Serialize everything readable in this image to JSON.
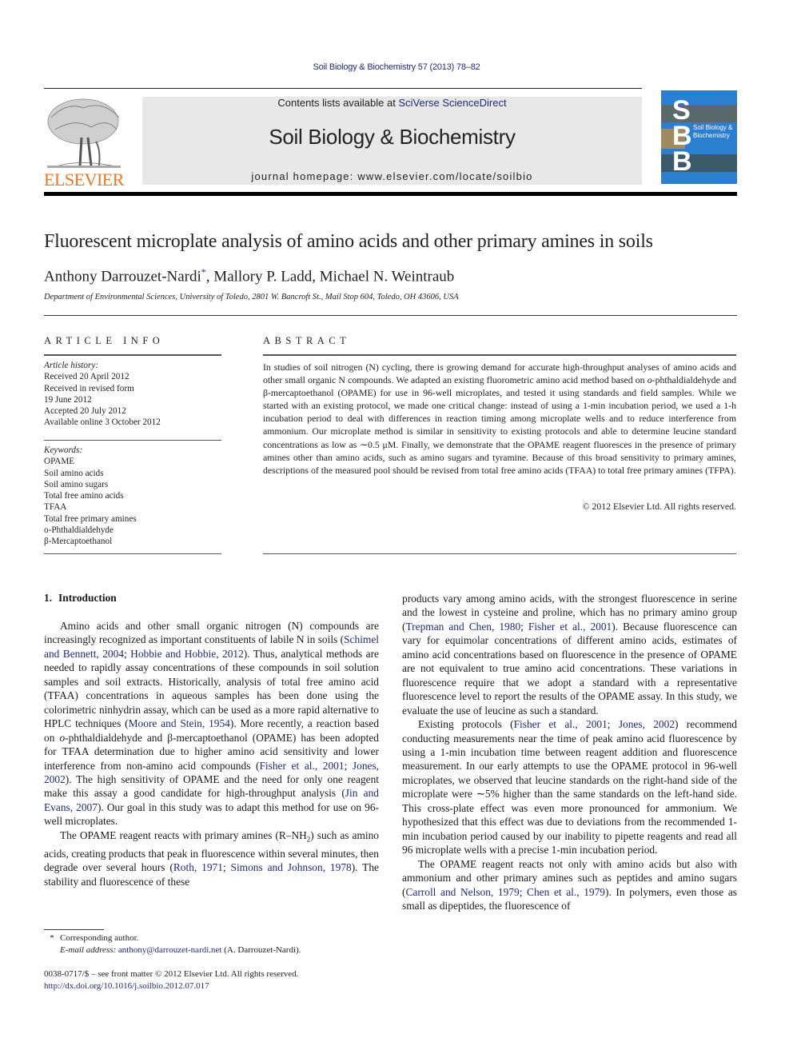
{
  "running_head": "Soil Biology & Biochemistry 57 (2013) 78–82",
  "masthead": {
    "contents_prefix": "Contents lists available at ",
    "contents_link": "SciVerse ScienceDirect",
    "journal_name": "Soil Biology & Biochemistry",
    "homepage_prefix": "journal homepage: ",
    "homepage_url": "www.elsevier.com/locate/soilbio",
    "publisher_logo_text": "ELSEVIER",
    "cover": {
      "letters": [
        "S",
        "B",
        "B"
      ],
      "title_line1": "Soil Biology &",
      "title_line2": "Biochemistry"
    },
    "colors": {
      "elsevier_orange": "#e87722",
      "link_blue": "#1f2a7a",
      "cover_blue": "#2a7fd0",
      "box_gray": "#e8e8e8"
    }
  },
  "article": {
    "title": "Fluorescent microplate analysis of amino acids and other primary amines in soils",
    "authors": [
      {
        "name": "Anthony Darrouzet-Nardi",
        "mark": "*"
      },
      {
        "name": "Mallory P. Ladd"
      },
      {
        "name": "Michael N. Weintraub"
      }
    ],
    "author_sep": ", ",
    "affiliation": "Department of Environmental Sciences, University of Toledo, 2801 W. Bancroft St., Mail Stop 604, Toledo, OH 43606, USA"
  },
  "article_info": {
    "heading": "ARTICLE INFO",
    "history_label": "Article history:",
    "history": [
      "Received 20 April 2012",
      "Received in revised form",
      "19 June 2012",
      "Accepted 20 July 2012",
      "Available online 3 October 2012"
    ],
    "keywords_label": "Keywords:",
    "keywords": [
      "OPAME",
      "Soil amino acids",
      "Soil amino sugars",
      "Total free amino acids",
      "TFAA",
      "Total free primary amines",
      "o-Phthaldialdehyde",
      "β-Mercaptoethanol"
    ]
  },
  "abstract": {
    "heading": "ABSTRACT",
    "text_1": "In studies of soil nitrogen (N) cycling, there is growing demand for accurate high-throughput analyses of amino acids and other small organic N compounds. We adapted an existing fluorometric amino acid method based on ",
    "text_italic": "o",
    "text_2": "-phthaldialdehyde and β-mercaptoethanol (OPAME) for use in 96-well microplates, and tested it using standards and field samples. While we started with an existing protocol, we made one critical change: instead of using a 1-min incubation period, we used a 1-h incubation period to deal with differences in reaction timing among microplate wells and to reduce interference from ammonium. Our microplate method is similar in sensitivity to existing protocols and able to determine leucine standard concentrations as low as ∼0.5 μM. Finally, we demonstrate that the OPAME reagent fluoresces in the presence of primary amines other than amino acids, such as amino sugars and tyramine. Because of this broad sensitivity to primary amines, descriptions of the measured pool should be revised from total free amino acids (TFAA) to total free primary amines (TFPA).",
    "copyright": "© 2012 Elsevier Ltd. All rights reserved."
  },
  "introduction": {
    "number": "1.",
    "heading": "Introduction",
    "left_col": {
      "p1_a": "Amino acids and other small organic nitrogen (N) compounds are increasingly recognized as important constituents of labile N in soils (",
      "p1_l1": "Schimel and Bennett, 2004",
      "p1_b": "; ",
      "p1_l2": "Hobbie and Hobbie, 2012",
      "p1_c": "). Thus, analytical methods are needed to rapidly assay concentrations of these compounds in soil solution samples and soil extracts. Historically, analysis of total free amino acid (TFAA) concentrations in aqueous samples has been done using the colorimetric ninhydrin assay, which can be used as a more rapid alternative to HPLC techniques (",
      "p1_l3": "Moore and Stein, 1954",
      "p1_d": "). More recently, a reaction based on ",
      "p1_i": "o",
      "p1_e": "-phthaldialdehyde and β-mercaptoethanol (OPAME) has been adopted for TFAA determination due to higher amino acid sensitivity and lower interference from non-amino acid compounds (",
      "p1_l4": "Fisher et al., 2001",
      "p1_f": "; ",
      "p1_l5": "Jones, 2002",
      "p1_g": "). The high sensitivity of OPAME and the need for only one reagent make this assay a good candidate for high-throughput analysis (",
      "p1_l6": "Jin and Evans, 2007",
      "p1_h": "). Our goal in this study was to adapt this method for use on 96-well microplates.",
      "p2_a": "The OPAME reagent reacts with primary amines (R–NH",
      "p2_sub": "2",
      "p2_b": ") such as amino acids, creating products that peak in fluorescence within several minutes, then degrade over several hours (",
      "p2_l1": "Roth, 1971",
      "p2_c": "; ",
      "p2_l2": "Simons and Johnson, 1978",
      "p2_d": "). The stability and fluorescence of these"
    },
    "right_col": {
      "p1_a": "products vary among amino acids, with the strongest fluorescence in serine and the lowest in cysteine and proline, which has no primary amino group (",
      "p1_l1": "Trepman and Chen, 1980",
      "p1_b": "; ",
      "p1_l2": "Fisher et al., 2001",
      "p1_c": "). Because fluorescence can vary for equimolar concentrations of different amino acids, estimates of amino acid concentrations based on fluorescence in the presence of OPAME are not equivalent to true amino acid concentrations. These variations in fluorescence require that we adopt a standard with a representative fluorescence level to report the results of the OPAME assay. In this study, we evaluate the use of leucine as such a standard.",
      "p2_a": "Existing protocols (",
      "p2_l1": "Fisher et al., 2001",
      "p2_b": "; ",
      "p2_l2": "Jones, 2002",
      "p2_c": ") recommend conducting measurements near the time of peak amino acid fluorescence by using a 1-min incubation time between reagent addition and fluorescence measurement. In our early attempts to use the OPAME protocol in 96-well microplates, we observed that leucine standards on the right-hand side of the microplate were ∼5% higher than the same standards on the left-hand side. This cross-plate effect was even more pronounced for ammonium. We hypothesized that this effect was due to deviations from the recommended 1-min incubation period caused by our inability to pipette reagents and read all 96 microplate wells with a precise 1-min incubation period.",
      "p3_a": "The OPAME reagent reacts not only with amino acids but also with ammonium and other primary amines such as peptides and amino sugars (",
      "p3_l1": "Carroll and Nelson, 1979",
      "p3_b": "; ",
      "p3_l2": "Chen et al., 1979",
      "p3_c": "). In polymers, even those as small as dipeptides, the fluorescence of"
    }
  },
  "footnotes": {
    "mark": "*",
    "corresponding": "Corresponding author.",
    "email_label": "E-mail address:",
    "email": "anthony@darrouzet-nardi.net",
    "email_owner": "(A. Darrouzet-Nardi).",
    "issn_line": "0038-0717/$ – see front matter © 2012 Elsevier Ltd. All rights reserved.",
    "doi": "http://dx.doi.org/10.1016/j.soilbio.2012.07.017"
  }
}
